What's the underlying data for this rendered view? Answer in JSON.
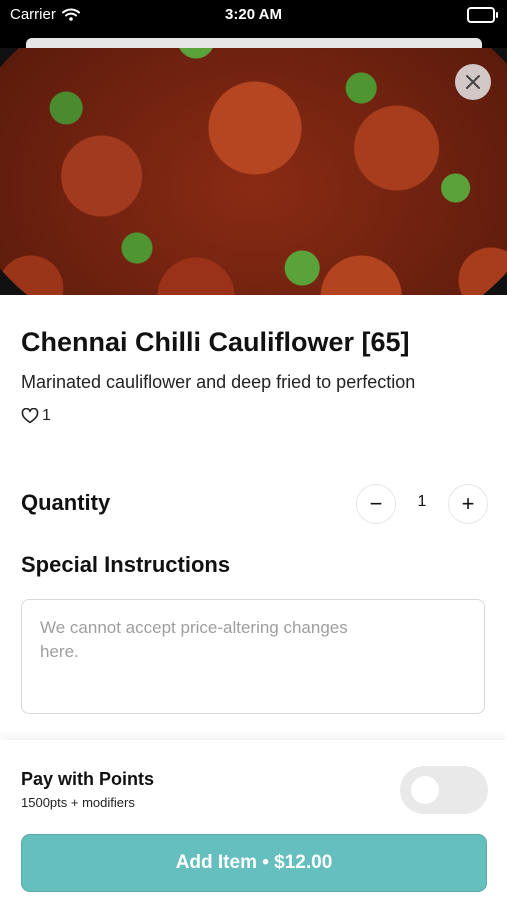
{
  "status_bar": {
    "carrier": "Carrier",
    "time": "3:20 AM"
  },
  "item": {
    "title": "Chennai Chilli Cauliflower [65]",
    "description": "Marinated cauliflower and deep fried to perfection",
    "likes": "1"
  },
  "quantity": {
    "label": "Quantity",
    "value": "1",
    "minus": "−",
    "plus": "+"
  },
  "special_instructions": {
    "label": "Special Instructions",
    "placeholder": "We cannot accept price-altering changes here."
  },
  "points": {
    "title": "Pay with Points",
    "subtitle": "1500pts + modifiers",
    "enabled": false
  },
  "add_button": {
    "label": "Add Item • $12.00"
  },
  "colors": {
    "accent": "#65bfbf",
    "toggle_off": "#e9e9ea"
  }
}
